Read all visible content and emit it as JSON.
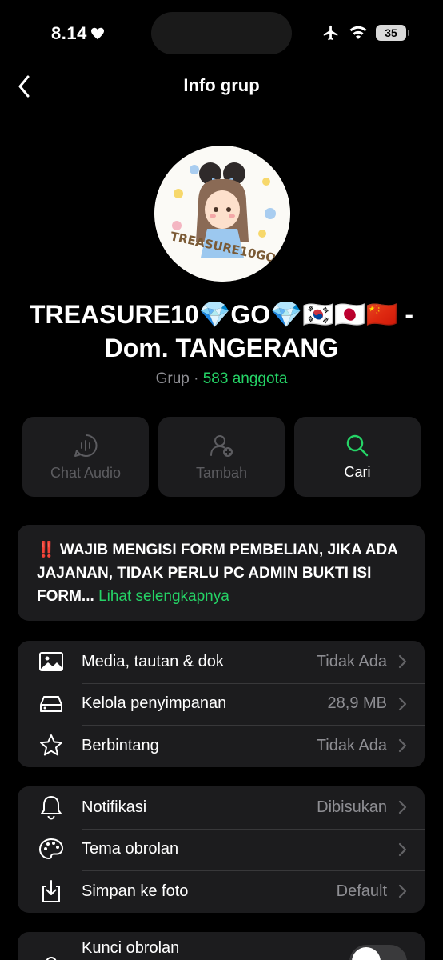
{
  "status_bar": {
    "time": "8.14",
    "battery": "35"
  },
  "nav": {
    "title": "Info grup"
  },
  "group": {
    "name_line1": "TREASURE10💎GO💎🇰🇷🇯🇵🇨🇳 -",
    "name_line2": "Dom. TANGERANG",
    "type": "Grup",
    "separator": " · ",
    "members": "583 anggota",
    "avatar_text": "TREASURE10GO"
  },
  "actions": [
    {
      "label": "Chat Audio",
      "enabled": false
    },
    {
      "label": "Tambah",
      "enabled": false
    },
    {
      "label": "Cari",
      "enabled": true
    }
  ],
  "description": {
    "text": "‼️ WAJIB MENGISI FORM PEMBELIAN, JIKA ADA JAJANAN, TIDAK PERLU PC ADMIN BUKTI ISI FORM... ",
    "more": "Lihat selengkapnya"
  },
  "section1": [
    {
      "label": "Media, tautan & dok",
      "value": "Tidak Ada",
      "icon": "photo-icon"
    },
    {
      "label": "Kelola penyimpanan",
      "value": "28,9 MB",
      "icon": "storage-icon"
    },
    {
      "label": "Berbintang",
      "value": "Tidak Ada",
      "icon": "star-icon"
    }
  ],
  "section2": [
    {
      "label": "Notifikasi",
      "value": "Dibisukan",
      "icon": "bell-icon"
    },
    {
      "label": "Tema obrolan",
      "value": "",
      "icon": "palette-icon"
    },
    {
      "label": "Simpan ke foto",
      "value": "Default",
      "icon": "download-icon"
    }
  ],
  "section3": [
    {
      "label": "Kunci obrolan",
      "icon": "lock-icon",
      "toggle": false
    }
  ],
  "colors": {
    "accent": "#25d366",
    "card": "#1c1c1e",
    "muted": "#8e8e93"
  }
}
